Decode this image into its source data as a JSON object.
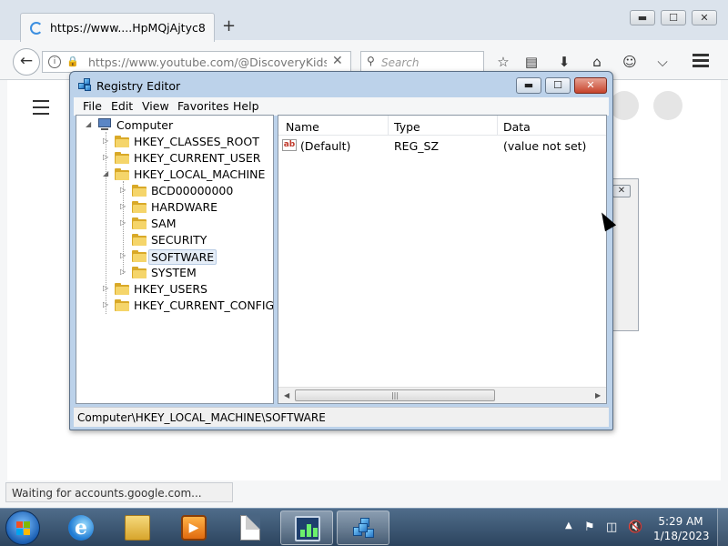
{
  "browser": {
    "tab": {
      "title": "https://www....HpMQjAjtyc8"
    },
    "new_tab_label": "+",
    "window_controls": {
      "minimize": "▬",
      "maximize": "☐",
      "close": "✕"
    },
    "url": "https://www.youtube.com/@DiscoveryKidsl",
    "search_placeholder": "Search",
    "status": "Waiting for accounts.google.com..."
  },
  "background_dialog": {
    "close": "✕"
  },
  "regedit": {
    "title": "Registry Editor",
    "window_controls": {
      "minimize": "▬",
      "maximize": "☐",
      "close": "✕"
    },
    "menu": [
      "File",
      "Edit",
      "View",
      "Favorites",
      "Help"
    ],
    "tree": {
      "root": "Computer",
      "hives": [
        "HKEY_CLASSES_ROOT",
        "HKEY_CURRENT_USER",
        "HKEY_LOCAL_MACHINE"
      ],
      "hklm_children": [
        "BCD00000000",
        "HARDWARE",
        "SAM",
        "SECURITY",
        "SOFTWARE",
        "SYSTEM"
      ],
      "hives_after": [
        "HKEY_USERS",
        "HKEY_CURRENT_CONFIG"
      ],
      "selected": "SOFTWARE"
    },
    "list": {
      "columns": [
        "Name",
        "Type",
        "Data"
      ],
      "rows": [
        {
          "icon": "string-value-icon",
          "icon_text": "ab",
          "name": "(Default)",
          "type": "REG_SZ",
          "data": "(value not set)"
        }
      ]
    },
    "status_path": "Computer\\HKEY_LOCAL_MACHINE\\SOFTWARE"
  },
  "taskbar": {
    "ie_letter": "e",
    "clock_time": "5:29 AM",
    "clock_date": "1/18/2023"
  },
  "colors": {
    "window_frame": "#bcd2ea",
    "taskbar": "#2c445e",
    "folder": "#f5d56a",
    "close_red": "#c6432b"
  }
}
